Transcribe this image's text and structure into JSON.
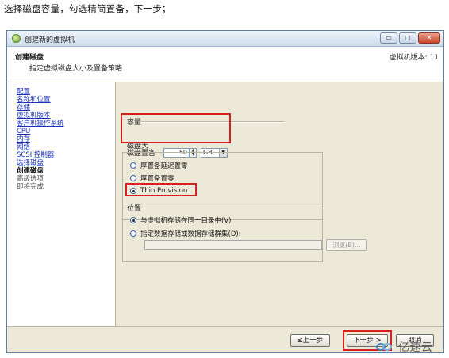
{
  "caption": "选择磁盘容量，勾选精简置备，下一步；",
  "window": {
    "title": "创建新的虚拟机",
    "controls": {
      "minimize": "▭",
      "maximize": "▢",
      "close": "✕"
    }
  },
  "header": {
    "title": "创建磁盘",
    "subtitle": "指定虚拟磁盘大小及置备策略",
    "version": "虚拟机版本: 11"
  },
  "nav": {
    "items": [
      {
        "label": "配置",
        "state": "link"
      },
      {
        "label": "名称和位置",
        "state": "link"
      },
      {
        "label": "存储",
        "state": "link"
      },
      {
        "label": "虚拟机版本",
        "state": "link"
      },
      {
        "label": "客户机操作系统",
        "state": "link"
      },
      {
        "label": "CPU",
        "state": "link"
      },
      {
        "label": "内存",
        "state": "link"
      },
      {
        "label": "网络",
        "state": "link"
      },
      {
        "label": "SCSI 控制器",
        "state": "link"
      },
      {
        "label": "选择磁盘",
        "state": "link"
      },
      {
        "label": "创建磁盘",
        "state": "current"
      },
      {
        "label": "高级选项",
        "state": "future"
      },
      {
        "label": "即将完成",
        "state": "future"
      }
    ]
  },
  "capacity": {
    "group_label": "容量",
    "disk_size_label": "磁盘大",
    "disk_size_value": "50",
    "unit": "GB"
  },
  "provisioning": {
    "group_label": "磁盘置备",
    "options": [
      {
        "label": "厚置备延迟置零",
        "checked": false
      },
      {
        "label": "厚置备置零",
        "checked": false
      },
      {
        "label": "Thin Provision",
        "checked": true
      }
    ]
  },
  "location": {
    "group_label": "位置",
    "options": [
      {
        "label": "与虚拟机存储在同一目录中(V)",
        "checked": true
      },
      {
        "label": "指定数据存储或数据存储群集(D):",
        "checked": false
      }
    ],
    "path_value": "",
    "browse_label": "浏览(B)..."
  },
  "footer": {
    "back_label": "≤上一步",
    "next_label": "下一步 >",
    "cancel_label": "取消"
  },
  "watermark": {
    "text": "亿速云"
  },
  "colors": {
    "highlight": "#d62020",
    "link": "#1a2fb8",
    "dialog_bg": "#ece9d8"
  }
}
